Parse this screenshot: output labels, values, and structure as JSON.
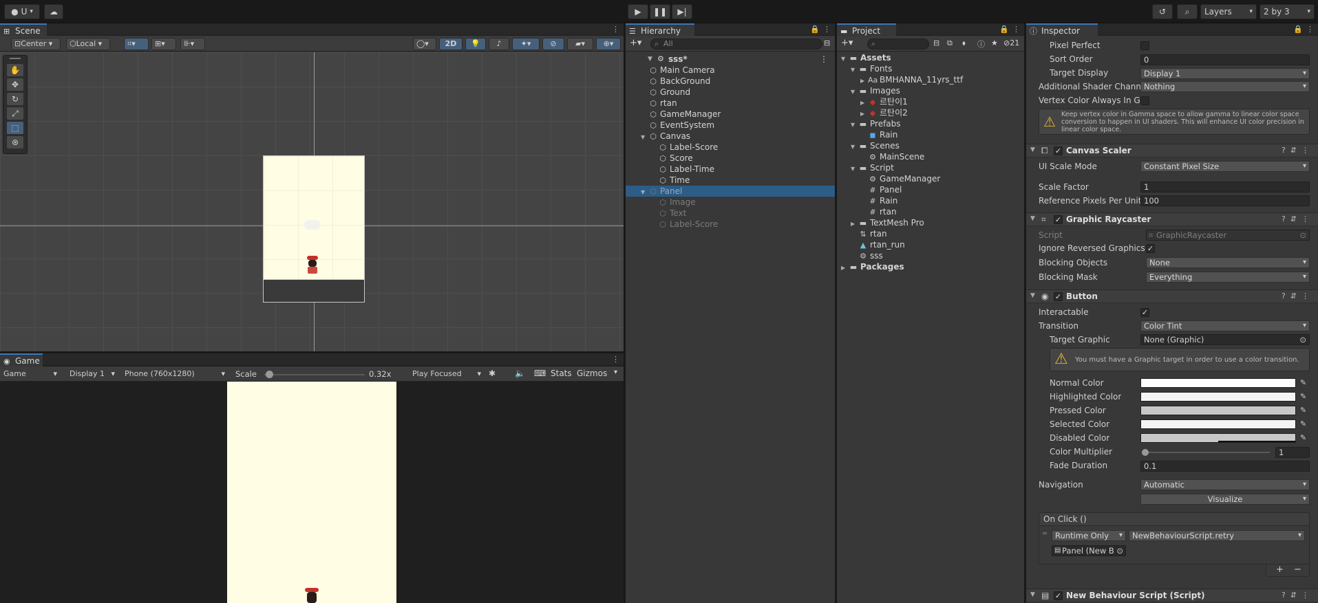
{
  "toolbar": {
    "account": "U",
    "layers": "Layers",
    "layout": "2 by 3"
  },
  "scene": {
    "tab": "Scene",
    "pivot": "Center",
    "space": "Local",
    "mode2d": "2D"
  },
  "game": {
    "tab": "Game",
    "view": "Game",
    "display": "Display 1",
    "resolution": "Phone (760x1280)",
    "scale_label": "Scale",
    "scale_value": "0.32x",
    "scale_fraction": 0.05,
    "play_mode": "Play Focused",
    "stats": "Stats",
    "gizmos": "Gizmos"
  },
  "hierarchy": {
    "tab": "Hierarchy",
    "search_placeholder": "All",
    "scene_name": "sss*",
    "items": [
      {
        "label": "Main Camera",
        "depth": 1,
        "icon": "cube-icon"
      },
      {
        "label": "BackGround",
        "depth": 1,
        "icon": "cube-icon"
      },
      {
        "label": "Ground",
        "depth": 1,
        "icon": "cube-icon"
      },
      {
        "label": "rtan",
        "depth": 1,
        "icon": "cube-icon"
      },
      {
        "label": "GameManager",
        "depth": 1,
        "icon": "cube-icon"
      },
      {
        "label": "EventSystem",
        "depth": 1,
        "icon": "cube-icon"
      },
      {
        "label": "Canvas",
        "depth": 1,
        "icon": "cube-icon",
        "expanded": true
      },
      {
        "label": "Label-Score",
        "depth": 2,
        "icon": "cube-icon"
      },
      {
        "label": "Score",
        "depth": 2,
        "icon": "cube-icon"
      },
      {
        "label": "Label-Time",
        "depth": 2,
        "icon": "cube-icon"
      },
      {
        "label": "Time",
        "depth": 2,
        "icon": "cube-icon"
      },
      {
        "label": "Panel",
        "depth": 1,
        "icon": "cube-icon",
        "expanded": true,
        "selected": true,
        "dim": true
      },
      {
        "label": "Image",
        "depth": 2,
        "icon": "cube-icon",
        "dim": true
      },
      {
        "label": "Text",
        "depth": 2,
        "icon": "cube-icon",
        "dim": true
      },
      {
        "label": "Label-Score",
        "depth": 2,
        "icon": "cube-icon",
        "dim": true
      }
    ]
  },
  "project": {
    "tab": "Project",
    "hidden_count": "21",
    "items": [
      {
        "label": "Assets",
        "depth": 0,
        "icon": "folder-icon",
        "expanded": true,
        "bold": true
      },
      {
        "label": "Fonts",
        "depth": 1,
        "icon": "folder-icon",
        "expanded": true
      },
      {
        "label": "BMHANNA_11yrs_ttf",
        "depth": 2,
        "icon": "font-icon",
        "collapsed": true
      },
      {
        "label": "Images",
        "depth": 1,
        "icon": "folder-icon",
        "expanded": true
      },
      {
        "label": "르탄이1",
        "depth": 2,
        "icon": "sprite-icon",
        "collapsed": true
      },
      {
        "label": "르탄이2",
        "depth": 2,
        "icon": "sprite-icon",
        "collapsed": true
      },
      {
        "label": "Prefabs",
        "depth": 1,
        "icon": "folder-icon",
        "expanded": true
      },
      {
        "label": "Rain",
        "depth": 2,
        "icon": "prefab-icon"
      },
      {
        "label": "Scenes",
        "depth": 1,
        "icon": "folder-icon",
        "expanded": true
      },
      {
        "label": "MainScene",
        "depth": 2,
        "icon": "unity-scene-icon"
      },
      {
        "label": "Script",
        "depth": 1,
        "icon": "folder-icon",
        "expanded": true
      },
      {
        "label": "GameManager",
        "depth": 2,
        "icon": "gear-icon"
      },
      {
        "label": "Panel",
        "depth": 2,
        "icon": "script-icon"
      },
      {
        "label": "Rain",
        "depth": 2,
        "icon": "script-icon"
      },
      {
        "label": "rtan",
        "depth": 2,
        "icon": "script-icon"
      },
      {
        "label": "TextMesh Pro",
        "depth": 1,
        "icon": "folder-icon",
        "collapsed": true
      },
      {
        "label": "rtan",
        "depth": 1,
        "icon": "animator-icon"
      },
      {
        "label": "rtan_run",
        "depth": 1,
        "icon": "animation-icon"
      },
      {
        "label": "sss",
        "depth": 1,
        "icon": "unity-scene-icon"
      },
      {
        "label": "Packages",
        "depth": 0,
        "icon": "folder-icon",
        "collapsed": true,
        "bold": true
      }
    ]
  },
  "inspector": {
    "tab": "Inspector",
    "canvas": {
      "pixel_perfect": "Pixel Perfect",
      "sort_order": "Sort Order",
      "sort_order_value": "0",
      "target_display": "Target Display",
      "target_display_value": "Display 1",
      "shader_channels": "Additional Shader Channe",
      "shader_channels_value": "Nothing",
      "vertex_color": "Vertex Color Always In Ga",
      "warning": "Keep vertex color in Gamma space to allow gamma to linear color space conversion to happen in UI shaders. This will enhance UI color precision in linear color space."
    },
    "canvas_scaler": {
      "title": "Canvas Scaler",
      "ui_scale_mode": "UI Scale Mode",
      "ui_scale_mode_value": "Constant Pixel Size",
      "scale_factor": "Scale Factor",
      "scale_factor_value": "1",
      "ref_ppu": "Reference Pixels Per Unit",
      "ref_ppu_value": "100"
    },
    "raycaster": {
      "title": "Graphic Raycaster",
      "script": "Script",
      "script_value": "GraphicRaycaster",
      "ignore_reversed": "Ignore Reversed Graphics",
      "blocking_objects": "Blocking Objects",
      "blocking_objects_value": "None",
      "blocking_mask": "Blocking Mask",
      "blocking_mask_value": "Everything"
    },
    "button": {
      "title": "Button",
      "interactable": "Interactable",
      "transition": "Transition",
      "transition_value": "Color Tint",
      "target_graphic": "Target Graphic",
      "target_graphic_value": "None (Graphic)",
      "warning": "You must have a Graphic target in order to use a color transition.",
      "normal_color": "Normal Color",
      "highlighted_color": "Highlighted Color",
      "pressed_color": "Pressed Color",
      "selected_color": "Selected Color",
      "disabled_color": "Disabled Color",
      "color_multiplier": "Color Multiplier",
      "color_multiplier_value": "1",
      "fade_duration": "Fade Duration",
      "fade_duration_value": "0.1",
      "navigation": "Navigation",
      "navigation_value": "Automatic",
      "visualize": "Visualize",
      "on_click": "On Click ()",
      "runtime": "Runtime Only",
      "function": "NewBehaviourScript.retry",
      "object": "Panel (New B",
      "add": "+",
      "remove": "−"
    },
    "new_script": {
      "title": "New Behaviour Script (Script)"
    }
  },
  "colors": {
    "selection": "#2c5d87",
    "accent": "#3a79bb",
    "game_bg": "#fffde3",
    "normal_color": "#ffffff",
    "highlighted_color": "#f5f5f5",
    "pressed_color": "#c8c8c8",
    "selected_color": "#f5f5f5",
    "disabled_color": "#c8c8c8"
  }
}
